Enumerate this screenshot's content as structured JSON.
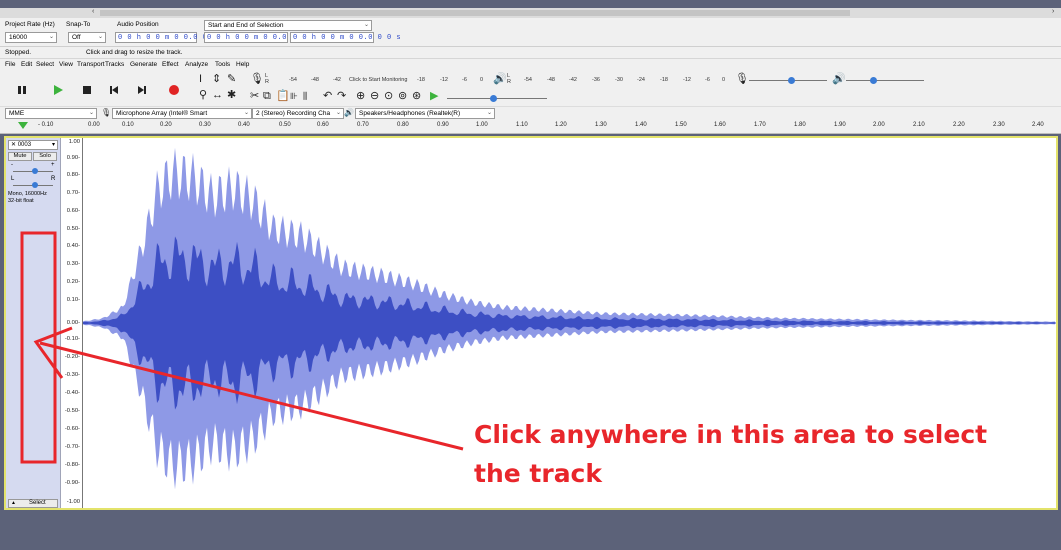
{
  "selection_toolbar": {
    "project_rate_label": "Project Rate (Hz)",
    "project_rate_value": "16000",
    "snap_to_label": "Snap-To",
    "snap_to_value": "Off",
    "audio_position_label": "Audio Position",
    "audio_position_value": "0 0 h 0 0 m 0 0.0 0 0 s",
    "selection_mode_label": "Start and End of Selection",
    "selection_start": "0 0 h 0 0 m 0 0.0 0 0 s",
    "selection_end": "0 0 h 0 0 m 0 0.0 0 0 s"
  },
  "status": {
    "state": "Stopped.",
    "hint": "Click and drag to resize the track."
  },
  "menu": [
    "File",
    "Edit",
    "Select",
    "View",
    "Transport",
    "Tracks",
    "Generate",
    "Effect",
    "Analyze",
    "Tools",
    "Help"
  ],
  "meters": {
    "record_scale": [
      "-54",
      "-48",
      "-42"
    ],
    "record_prompt": "Click to Start Monitoring",
    "record_scale2": [
      "-18",
      "-12",
      "-6",
      "0"
    ],
    "play_scale": [
      "-54",
      "-48",
      "-42",
      "-36",
      "-30",
      "-24",
      "-18",
      "-12",
      "-6",
      "0"
    ],
    "lr": [
      "L",
      "R"
    ]
  },
  "devices": {
    "host": "MME",
    "input": "Microphone Array (Intel® Smart",
    "channels": "2 (Stereo) Recording Cha",
    "output": "Speakers/Headphones (Realtek(R)"
  },
  "ruler": {
    "ticks": [
      "- 0.10",
      "0.00",
      "0.10",
      "0.20",
      "0.30",
      "0.40",
      "0.50",
      "0.60",
      "0.70",
      "0.80",
      "0.90",
      "1.00",
      "1.10",
      "1.20",
      "1.30",
      "1.40",
      "1.50",
      "1.60",
      "1.70",
      "1.80",
      "1.90",
      "2.00",
      "2.10",
      "2.20",
      "2.30",
      "2.40"
    ]
  },
  "track": {
    "name": "0003",
    "mute": "Mute",
    "solo": "Solo",
    "gain_minus": "-",
    "gain_plus": "+",
    "pan_l": "L",
    "pan_r": "R",
    "info_line1": "Mono, 16000Hz",
    "info_line2": "32-bit float",
    "select_label": "Select"
  },
  "vertical_scale": [
    "1.00",
    "0.90-",
    "0.80-",
    "0.70-",
    "0.60-",
    "0.50-",
    "0.40-",
    "0.30-",
    "0.20-",
    "0.10-",
    "0.00-",
    "-0.10-",
    "-0.20-",
    "-0.30-",
    "-0.40-",
    "-0.50-",
    "-0.60-",
    "-0.70-",
    "-0.80-",
    "-0.90-",
    "-1.00"
  ],
  "annotation": {
    "line1": "Click anywhere in this area to select",
    "line2": "the track",
    "color": "#e8262b"
  },
  "colors": {
    "wave_dark": "#3d4fc4",
    "wave_light": "#8e99e6",
    "track_bg": "#d5daf0",
    "frame": "#5c6279"
  }
}
